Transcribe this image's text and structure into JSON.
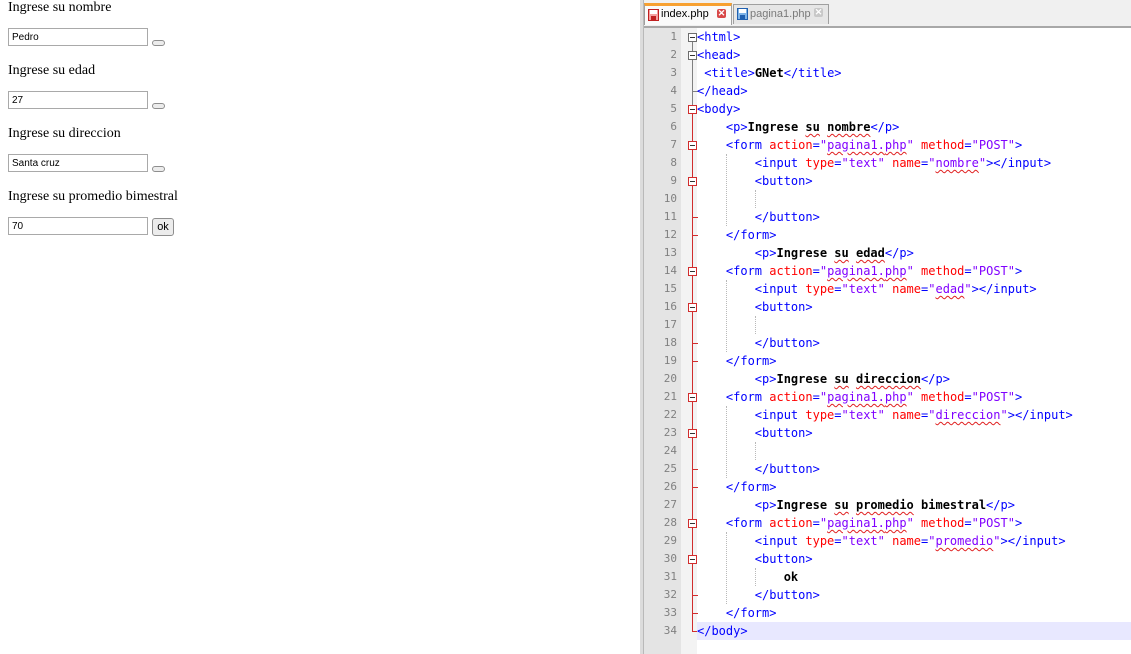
{
  "browser": {
    "labels": [
      "Ingrese su nombre",
      "Ingrese su edad",
      "Ingrese su direccion",
      "Ingrese su promedio bimestral"
    ],
    "inputs": [
      "Pedro",
      "27",
      "Santa cruz",
      "70"
    ],
    "ok_label": "ok"
  },
  "editor": {
    "tabs": [
      {
        "label": "index.php",
        "active": true
      },
      {
        "label": "pagina1.php",
        "active": false
      }
    ],
    "close_glyph": "✕",
    "line_numbers": [
      "1",
      "2",
      "3",
      "4",
      "5",
      "6",
      "7",
      "8",
      "9",
      "10",
      "11",
      "12",
      "13",
      "14",
      "15",
      "16",
      "17",
      "18",
      "19",
      "20",
      "21",
      "22",
      "23",
      "24",
      "25",
      "26",
      "27",
      "28",
      "29",
      "30",
      "31",
      "32",
      "33",
      "34"
    ],
    "code": [
      [
        [
          "tag",
          "<html>"
        ]
      ],
      [
        [
          "tag",
          "<head>"
        ]
      ],
      [
        [
          "plain",
          " "
        ],
        [
          "tag",
          "<title>"
        ],
        [
          "text",
          "GNet"
        ],
        [
          "tag",
          "</title>"
        ]
      ],
      [
        [
          "tag",
          "</head>"
        ]
      ],
      [
        [
          "tag",
          "<body>"
        ]
      ],
      [
        [
          "plain",
          "    "
        ],
        [
          "tag",
          "<p>"
        ],
        [
          "text",
          "Ingrese su nombre"
        ],
        [
          "tag",
          "</p>"
        ]
      ],
      [
        [
          "plain",
          "    "
        ],
        [
          "tag",
          "<form "
        ],
        [
          "attr",
          "action"
        ],
        [
          "tag",
          "="
        ],
        [
          "val",
          "\"pagina1.php\""
        ],
        [
          "tag",
          " "
        ],
        [
          "attr",
          "method"
        ],
        [
          "tag",
          "="
        ],
        [
          "val",
          "\"POST\""
        ],
        [
          "tag",
          ">"
        ]
      ],
      [
        [
          "plain",
          "        "
        ],
        [
          "tag",
          "<input "
        ],
        [
          "attr",
          "type"
        ],
        [
          "tag",
          "="
        ],
        [
          "val",
          "\"text\""
        ],
        [
          "tag",
          " "
        ],
        [
          "attr",
          "name"
        ],
        [
          "tag",
          "="
        ],
        [
          "val",
          "\"nombre\""
        ],
        [
          "tag",
          "></input>"
        ]
      ],
      [
        [
          "plain",
          "        "
        ],
        [
          "tag",
          "<button>"
        ]
      ],
      [
        [
          "plain",
          ""
        ]
      ],
      [
        [
          "plain",
          "        "
        ],
        [
          "tag",
          "</button>"
        ]
      ],
      [
        [
          "plain",
          "    "
        ],
        [
          "tag",
          "</form>"
        ]
      ],
      [
        [
          "plain",
          "        "
        ],
        [
          "tag",
          "<p>"
        ],
        [
          "text",
          "Ingrese su edad"
        ],
        [
          "tag",
          "</p>"
        ]
      ],
      [
        [
          "plain",
          "    "
        ],
        [
          "tag",
          "<form "
        ],
        [
          "attr",
          "action"
        ],
        [
          "tag",
          "="
        ],
        [
          "val",
          "\"pagina1.php\""
        ],
        [
          "tag",
          " "
        ],
        [
          "attr",
          "method"
        ],
        [
          "tag",
          "="
        ],
        [
          "val",
          "\"POST\""
        ],
        [
          "tag",
          ">"
        ]
      ],
      [
        [
          "plain",
          "        "
        ],
        [
          "tag",
          "<input "
        ],
        [
          "attr",
          "type"
        ],
        [
          "tag",
          "="
        ],
        [
          "val",
          "\"text\""
        ],
        [
          "tag",
          " "
        ],
        [
          "attr",
          "name"
        ],
        [
          "tag",
          "="
        ],
        [
          "val",
          "\"edad\""
        ],
        [
          "tag",
          "></input>"
        ]
      ],
      [
        [
          "plain",
          "        "
        ],
        [
          "tag",
          "<button>"
        ]
      ],
      [
        [
          "plain",
          ""
        ]
      ],
      [
        [
          "plain",
          "        "
        ],
        [
          "tag",
          "</button>"
        ]
      ],
      [
        [
          "plain",
          "    "
        ],
        [
          "tag",
          "</form>"
        ]
      ],
      [
        [
          "plain",
          "        "
        ],
        [
          "tag",
          "<p>"
        ],
        [
          "text",
          "Ingrese su direccion"
        ],
        [
          "tag",
          "</p>"
        ]
      ],
      [
        [
          "plain",
          "    "
        ],
        [
          "tag",
          "<form "
        ],
        [
          "attr",
          "action"
        ],
        [
          "tag",
          "="
        ],
        [
          "val",
          "\"pagina1.php\""
        ],
        [
          "tag",
          " "
        ],
        [
          "attr",
          "method"
        ],
        [
          "tag",
          "="
        ],
        [
          "val",
          "\"POST\""
        ],
        [
          "tag",
          ">"
        ]
      ],
      [
        [
          "plain",
          "        "
        ],
        [
          "tag",
          "<input "
        ],
        [
          "attr",
          "type"
        ],
        [
          "tag",
          "="
        ],
        [
          "val",
          "\"text\""
        ],
        [
          "tag",
          " "
        ],
        [
          "attr",
          "name"
        ],
        [
          "tag",
          "="
        ],
        [
          "val",
          "\"direccion\""
        ],
        [
          "tag",
          "></input>"
        ]
      ],
      [
        [
          "plain",
          "        "
        ],
        [
          "tag",
          "<button>"
        ]
      ],
      [
        [
          "plain",
          ""
        ]
      ],
      [
        [
          "plain",
          "        "
        ],
        [
          "tag",
          "</button>"
        ]
      ],
      [
        [
          "plain",
          "    "
        ],
        [
          "tag",
          "</form>"
        ]
      ],
      [
        [
          "plain",
          "        "
        ],
        [
          "tag",
          "<p>"
        ],
        [
          "text",
          "Ingrese su promedio bimestral"
        ],
        [
          "tag",
          "</p>"
        ]
      ],
      [
        [
          "plain",
          "    "
        ],
        [
          "tag",
          "<form "
        ],
        [
          "attr",
          "action"
        ],
        [
          "tag",
          "="
        ],
        [
          "val",
          "\"pagina1.php\""
        ],
        [
          "tag",
          " "
        ],
        [
          "attr",
          "method"
        ],
        [
          "tag",
          "="
        ],
        [
          "val",
          "\"POST\""
        ],
        [
          "tag",
          ">"
        ]
      ],
      [
        [
          "plain",
          "        "
        ],
        [
          "tag",
          "<input "
        ],
        [
          "attr",
          "type"
        ],
        [
          "tag",
          "="
        ],
        [
          "val",
          "\"text\""
        ],
        [
          "tag",
          " "
        ],
        [
          "attr",
          "name"
        ],
        [
          "tag",
          "="
        ],
        [
          "val",
          "\"promedio\""
        ],
        [
          "tag",
          "></input>"
        ]
      ],
      [
        [
          "plain",
          "        "
        ],
        [
          "tag",
          "<button>"
        ]
      ],
      [
        [
          "plain",
          "            "
        ],
        [
          "text",
          "ok"
        ]
      ],
      [
        [
          "plain",
          "        "
        ],
        [
          "tag",
          "</button>"
        ]
      ],
      [
        [
          "plain",
          "    "
        ],
        [
          "tag",
          "</form>"
        ]
      ],
      [
        [
          "tag",
          "</body>"
        ]
      ]
    ],
    "current_line": 34
  }
}
